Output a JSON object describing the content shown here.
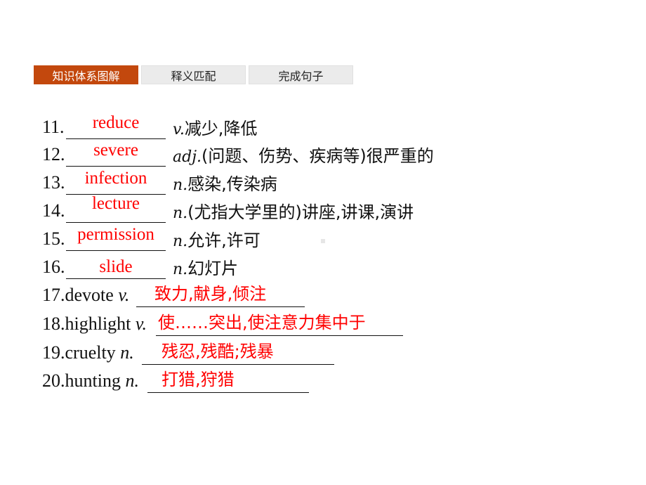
{
  "tabs": [
    {
      "label": "知识体系图解",
      "active": true
    },
    {
      "label": "释义匹配",
      "active": false
    },
    {
      "label": "完成句子",
      "active": false
    }
  ],
  "colors": {
    "accent": "#c3480d",
    "answer": "#ff0000"
  },
  "items_fill": [
    {
      "num": "11.",
      "answer": "reduce",
      "pos": "v.",
      "definition": "减少,降低"
    },
    {
      "num": "12.",
      "answer": "severe",
      "pos": "adj.",
      "definition": "(问题、伤势、疾病等)很严重的"
    },
    {
      "num": "13.",
      "answer": "infection",
      "pos": "n.",
      "definition": "感染,传染病"
    },
    {
      "num": "14.",
      "answer": "lecture",
      "pos": "n.",
      "definition": "(尤指大学里的)讲座,讲课,演讲"
    },
    {
      "num": "15.",
      "answer": "permission",
      "pos": "n.",
      "definition": "允许,许可"
    },
    {
      "num": "16.",
      "answer": "slide",
      "pos": "n.",
      "definition": "幻灯片"
    }
  ],
  "items_meaning": [
    {
      "num": "17.",
      "word": "devote",
      "pos": "v.",
      "answer": "致力,献身,倾注"
    },
    {
      "num": "18.",
      "word": "highlight",
      "pos": "v.",
      "answer": "使……突出,使注意力集中于"
    },
    {
      "num": "19.",
      "word": "cruelty",
      "pos": "n.",
      "answer": "残忍,残酷;残暴"
    },
    {
      "num": "20.",
      "word": "hunting",
      "pos": "n.",
      "answer": "打猎,狩猎"
    }
  ]
}
